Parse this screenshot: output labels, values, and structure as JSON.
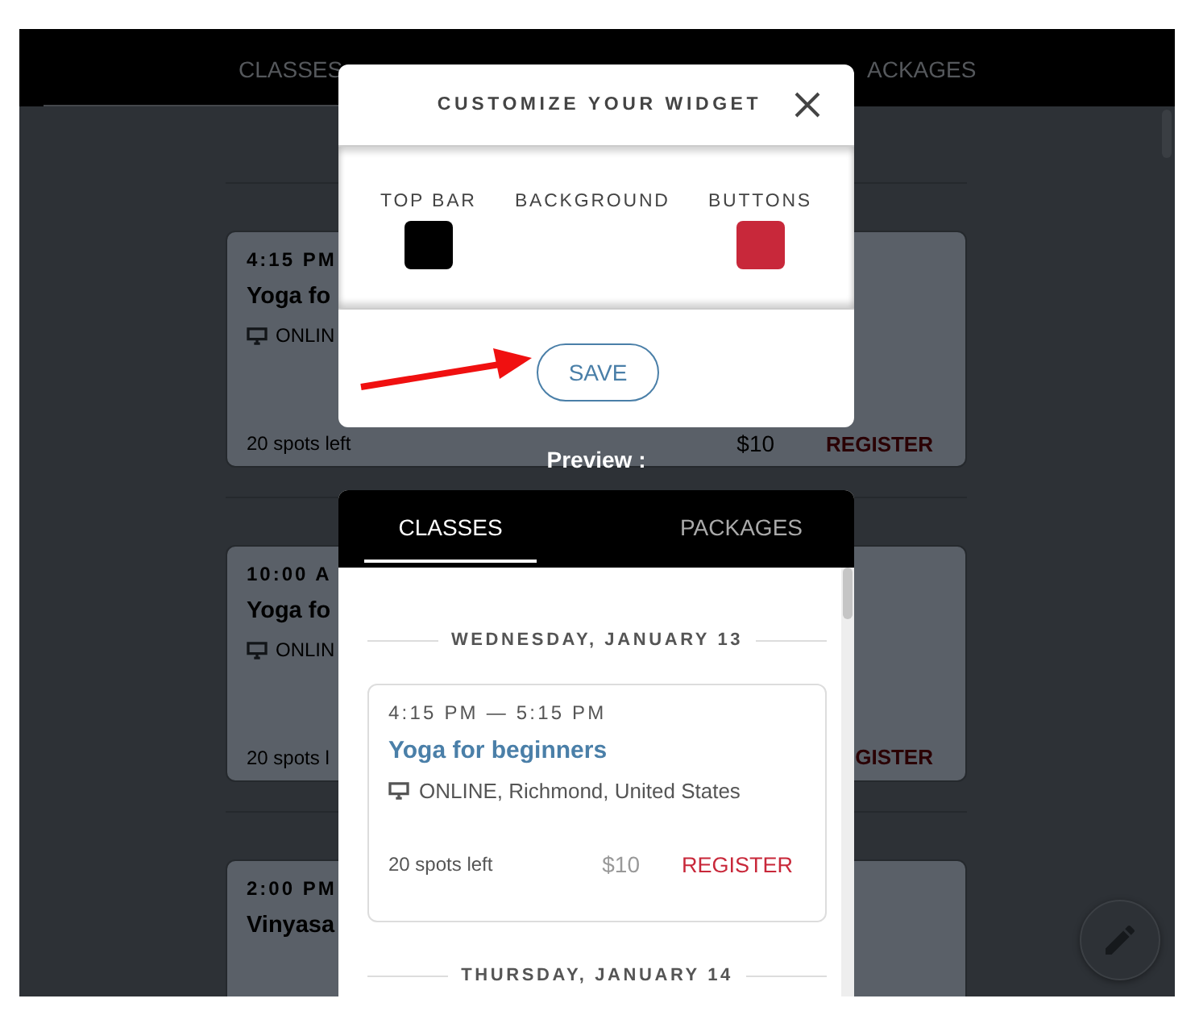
{
  "background_page": {
    "tabs": [
      {
        "label": "CLASSES",
        "selected": true
      },
      {
        "label": "ACKAGES",
        "selected": false
      }
    ],
    "cards": [
      {
        "time": "4:15 PM",
        "title": "Yoga fo",
        "location": "ONLIN",
        "spots": "20 spots left",
        "price": "$10",
        "action": "REGISTER"
      },
      {
        "time": "10:00 A",
        "title": "Yoga fo",
        "location": "ONLIN",
        "spots": "20 spots l",
        "action": "GISTER"
      },
      {
        "time": "2:00 PM",
        "title": "Vinyasa"
      }
    ]
  },
  "modal": {
    "title": "CUSTOMIZE YOUR WIDGET",
    "color_options": [
      {
        "label": "TOP BAR",
        "color": "#000000"
      },
      {
        "label": "BACKGROUND"
      },
      {
        "label": "BUTTONS",
        "color": "#c8283a"
      }
    ],
    "save_button": "SAVE"
  },
  "preview_label": "Preview :",
  "preview": {
    "tabs": [
      {
        "label": "CLASSES",
        "selected": true
      },
      {
        "label": "PACKAGES",
        "selected": false
      }
    ],
    "days": [
      {
        "date": "WEDNESDAY, JANUARY 13",
        "classes": [
          {
            "time": "4:15 PM — 5:15 PM",
            "title": "Yoga for beginners",
            "location": "ONLINE, Richmond, United States",
            "spots": "20 spots left",
            "price": "$10",
            "action": "REGISTER"
          }
        ]
      },
      {
        "date": "THURSDAY, JANUARY 14"
      }
    ]
  }
}
